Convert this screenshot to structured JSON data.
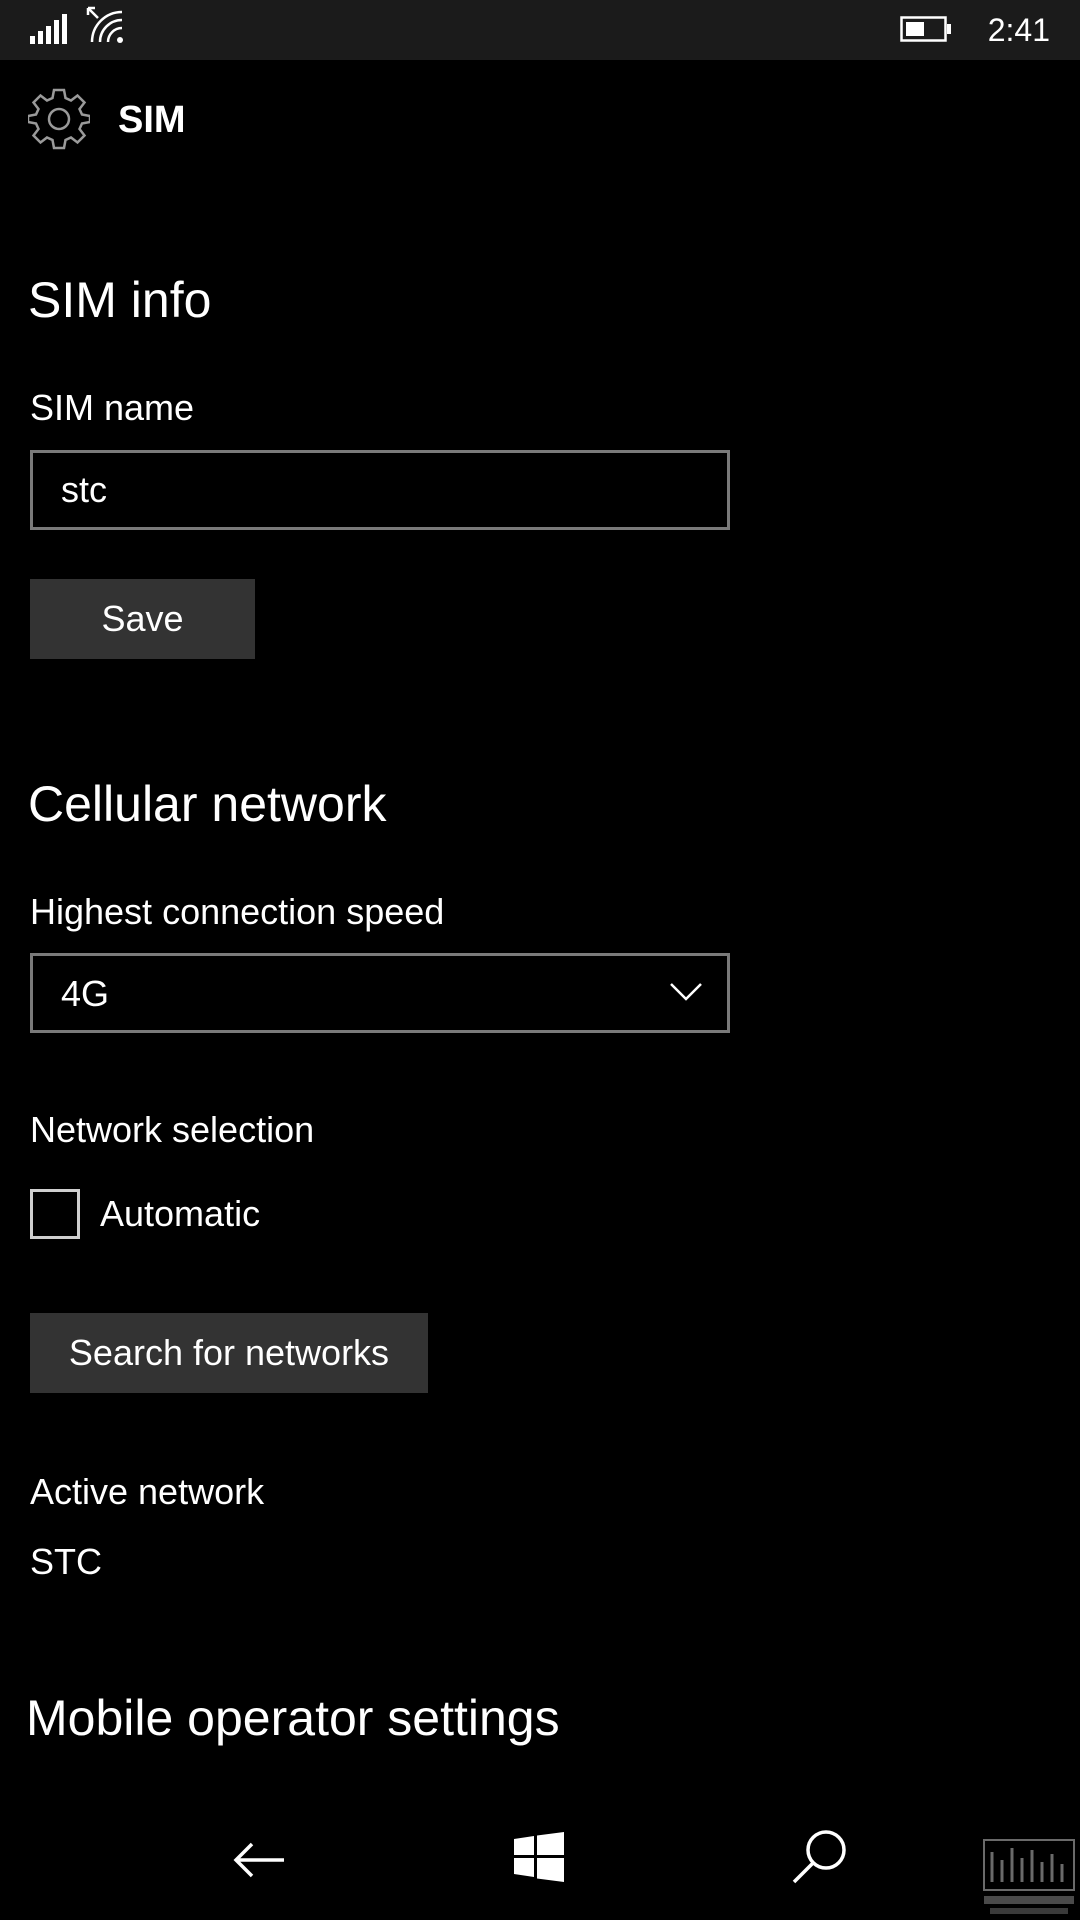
{
  "status_bar": {
    "time": "2:41",
    "icons": [
      "signal-icon",
      "wifi-icon",
      "battery-icon"
    ]
  },
  "header": {
    "icon": "gear-icon",
    "title": "SIM"
  },
  "sim_info": {
    "heading": "SIM info",
    "name_label": "SIM name",
    "name_value": "stc",
    "save_label": "Save"
  },
  "cellular": {
    "heading": "Cellular network",
    "speed_label": "Highest connection speed",
    "speed_value": "4G",
    "selection_label": "Network selection",
    "automatic_label": "Automatic",
    "automatic_checked": false,
    "search_label": "Search for networks",
    "active_label": "Active network",
    "active_value": "STC"
  },
  "operator": {
    "heading": "Mobile operator settings"
  },
  "nav_bar": {
    "icons": [
      "back-arrow-icon",
      "windows-logo-icon",
      "search-icon"
    ]
  },
  "colors": {
    "background": "#000000",
    "status_bar": "#1b1b1b",
    "button": "#333333",
    "border": "#7a7a7a",
    "text": "#ffffff"
  }
}
